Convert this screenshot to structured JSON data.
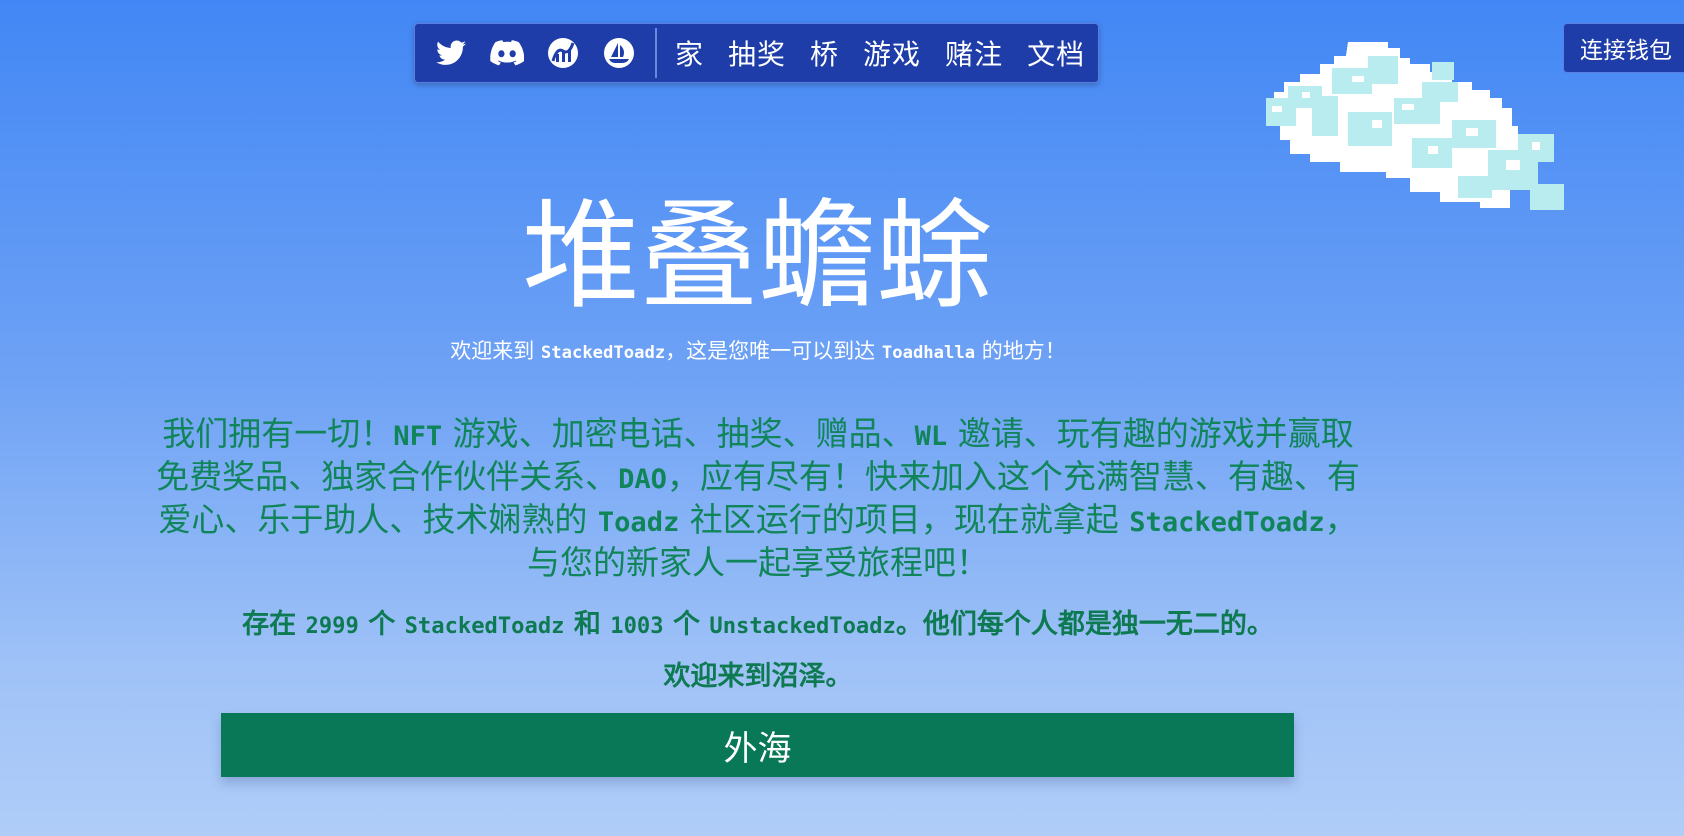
{
  "nav": {
    "social_icons": [
      "twitter-icon",
      "discord-icon",
      "dextools-icon",
      "opensea-icon"
    ],
    "links": [
      {
        "label": "家"
      },
      {
        "label": "抽奖"
      },
      {
        "label": "桥"
      },
      {
        "label": "游戏"
      },
      {
        "label": "赌注"
      },
      {
        "label": "文档"
      }
    ],
    "colors": {
      "bar": "#1e3da8",
      "text": "#ffffff"
    }
  },
  "wallet": {
    "label": "连接钱包"
  },
  "hero": {
    "title": "堆叠蟾蜍",
    "subtitle": {
      "part1": "欢迎来到 ",
      "brand": "StackedToadz",
      "part2": "，这是您唯一可以到达 ",
      "place": "Toadhalla",
      "part3": " 的地方！"
    }
  },
  "description": {
    "t1": "我们拥有一切！",
    "m1": "NFT",
    "t2": " 游戏、加密电话、抽奖、赠品、",
    "m2": "WL",
    "t3": " 邀请、玩有趣的游戏并赢取免费奖品、独家合作伙伴关系、",
    "m3": "DAO",
    "t4": "，应有尽有！快来加入这个充满智慧、有趣、有爱心、乐于助人、技术娴熟的 ",
    "m4": "Toadz",
    "t5": " 社区运行的项目，现在就拿起 ",
    "m5": "StackedToadz",
    "t6": "，与您的新家人一起享受旅程吧！"
  },
  "counts": {
    "t1": "存在 ",
    "stacked_count": "2999",
    "t2": " 个 ",
    "stacked_name": "StackedToadz",
    "t3": " 和 ",
    "unstacked_count": "1003",
    "t4": " 个 ",
    "unstacked_name": "UnstackedToadz",
    "t5": "。他们每个人都是独一无二的。"
  },
  "welcome": "欢迎来到沼泽。",
  "cta": {
    "label": "外海"
  },
  "colors": {
    "bg_top": "#4287f5",
    "bg_bottom": "#b0cdf8",
    "accent_green": "#087856",
    "text_green": "#10855a"
  }
}
